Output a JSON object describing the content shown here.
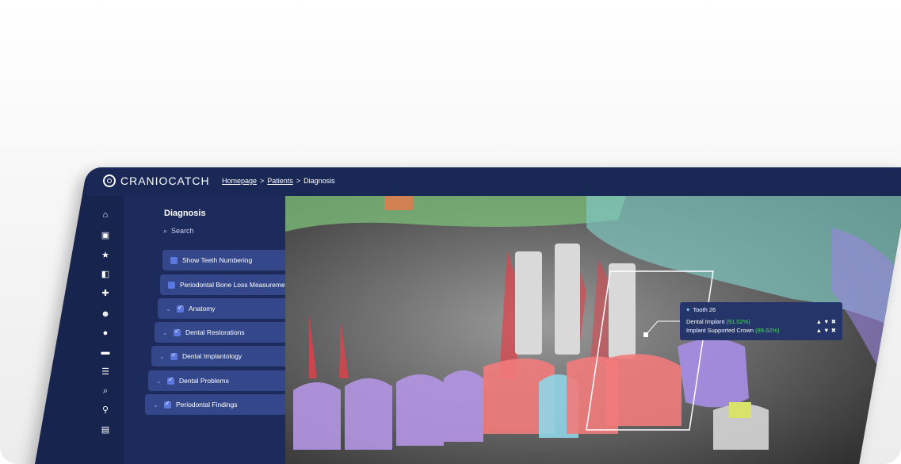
{
  "app": {
    "logo_text": "CRANIOCATCH"
  },
  "breadcrumb": {
    "home": "Homepage",
    "patients": "Patients",
    "current": "Diagnosis",
    "sep": ">"
  },
  "rail": {
    "icons": [
      "home-icon",
      "folder-icon",
      "star-icon",
      "patient-card-icon",
      "add-user-icon",
      "users-icon",
      "user-icon",
      "card-icon",
      "list-icon",
      "zoom-icon",
      "walk-icon",
      "clipboard-icon"
    ]
  },
  "panel": {
    "title": "Diagnosis",
    "collapse": "«",
    "search_placeholder": "Search",
    "toggles": [
      {
        "label": "Show Teeth Numbering"
      },
      {
        "label": "Periodontal Bone Loss Measurement"
      }
    ],
    "groups": [
      {
        "label": "Anatomy"
      },
      {
        "label": "Dental Restorations"
      },
      {
        "label": "Dental Implantology"
      },
      {
        "label": "Dental Problems"
      },
      {
        "label": "Periodontal Findings"
      }
    ]
  },
  "tooltip": {
    "title": "Tooth 26",
    "rows": [
      {
        "label": "Dental Implant",
        "score": "(91.02%)"
      },
      {
        "label": "Implant Supported Crown",
        "score": "(89.62%)"
      }
    ]
  },
  "colors": {
    "topbar": "#1a2856",
    "panel": "#1d2b5c",
    "item": "#33478a",
    "check": "#5b78e0",
    "score": "#4cd964"
  }
}
